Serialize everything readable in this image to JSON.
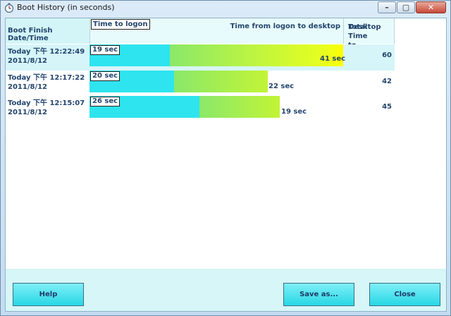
{
  "window": {
    "title": "Boot History (in seconds)"
  },
  "caption": {
    "minimize": "–",
    "maximize": "▢",
    "close": "✕"
  },
  "columns": {
    "date": "Boot Finish Date/Time",
    "logon": "Time to logon",
    "desktop": "Time from logon to desktop",
    "total_line1": "Total Time to",
    "total_line2": "Desktop"
  },
  "rows": [
    {
      "line1": "Today 下午 12:22:49",
      "line2": "2011/8/12",
      "logon": "19 sec",
      "desktop": "41 sec",
      "total": "60",
      "logon_seconds": 19,
      "desktop_seconds": 41,
      "selected": true
    },
    {
      "line1": "Today 下午 12:17:22",
      "line2": "2011/8/12",
      "logon": "20 sec",
      "desktop": "22 sec",
      "total": "42",
      "logon_seconds": 20,
      "desktop_seconds": 22,
      "selected": false
    },
    {
      "line1": "Today 下午 12:15:07",
      "line2": "2011/8/12",
      "logon": "26 sec",
      "desktop": "19 sec",
      "total": "45",
      "logon_seconds": 26,
      "desktop_seconds": 19,
      "selected": false
    }
  ],
  "buttons": {
    "help": "Help",
    "save": "Save as...",
    "close": "Close"
  },
  "colors": {
    "logon_bar": "#2ee4ef",
    "desktop_bar_start": "#8ae86a",
    "desktop_bar_end": "#ffff00",
    "background": "#d6f6f7"
  }
}
